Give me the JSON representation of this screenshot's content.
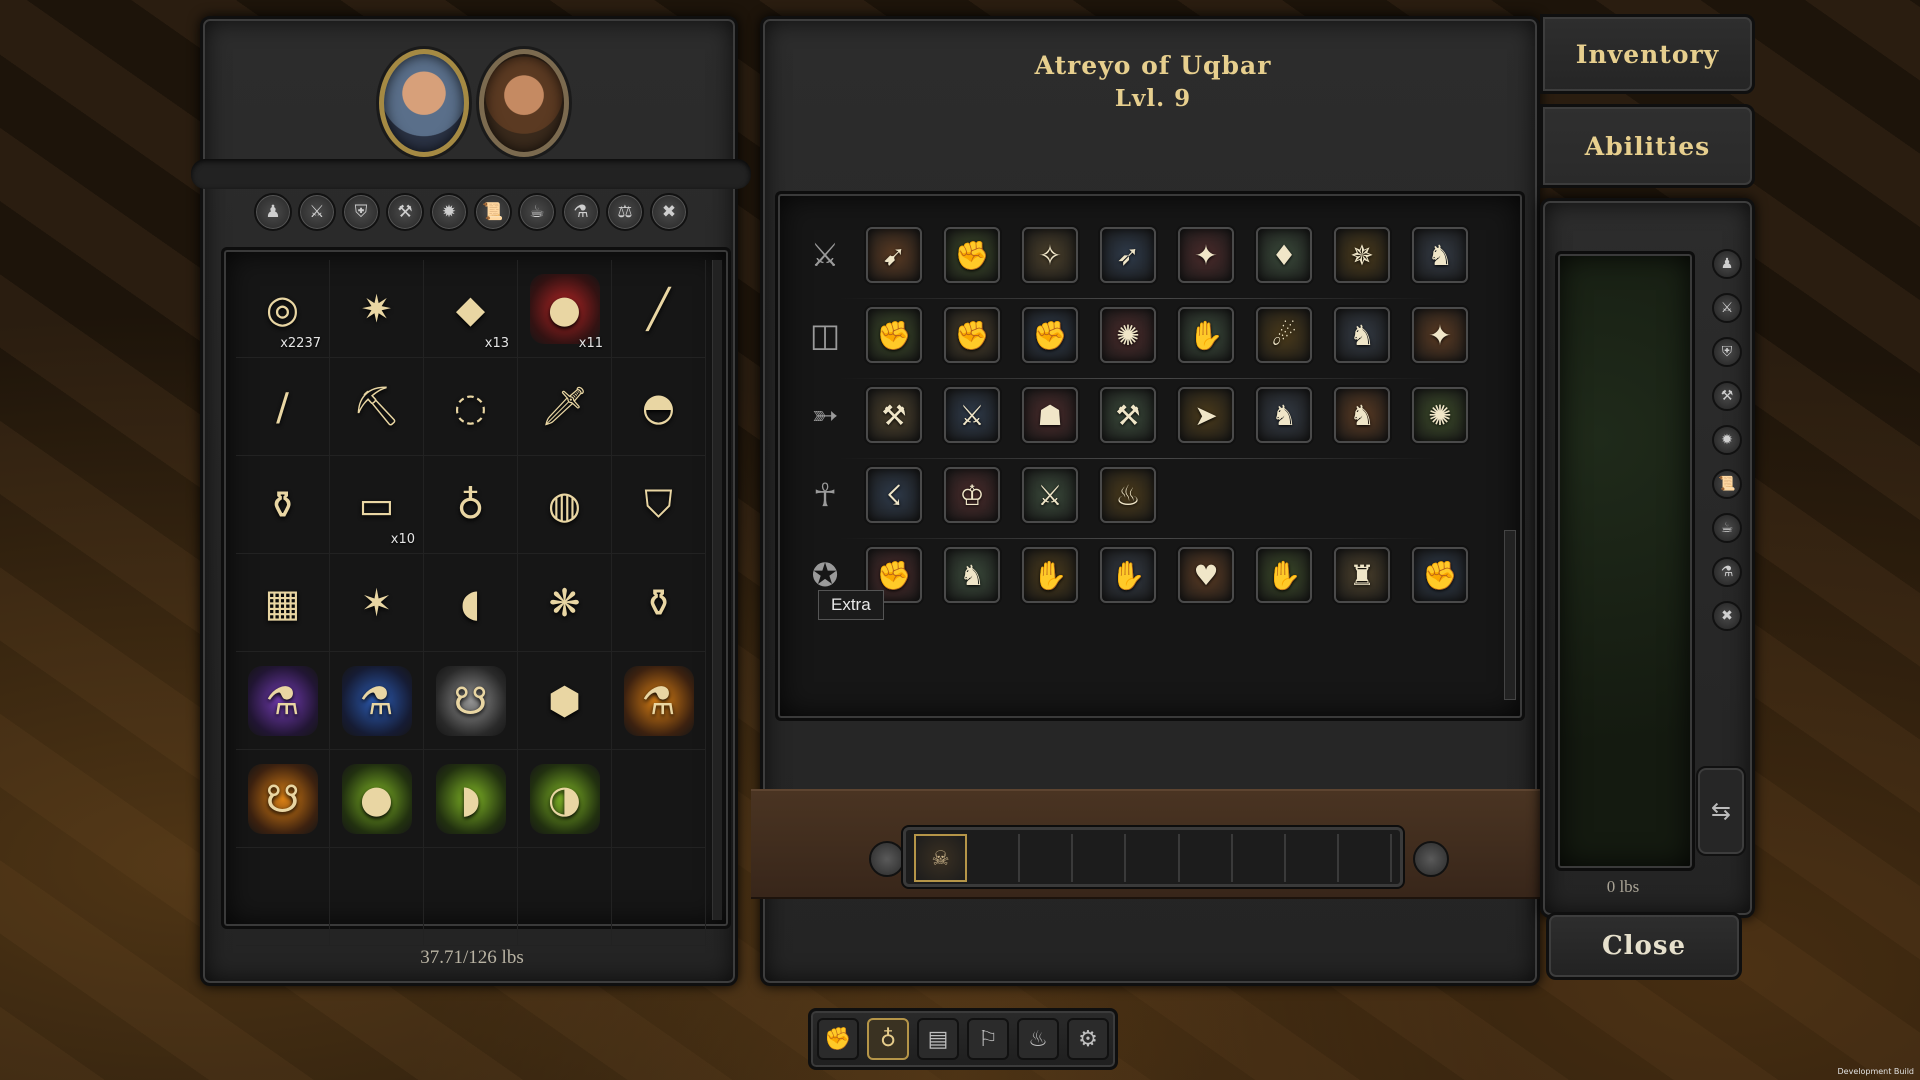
{
  "party": {
    "portraits": [
      {
        "name": "portrait-atreyo",
        "selected": true
      },
      {
        "name": "portrait-companion",
        "selected": false
      }
    ]
  },
  "inventory": {
    "filters": [
      {
        "name": "filter-all-icon",
        "glyph": "♟"
      },
      {
        "name": "filter-weapons-icon",
        "glyph": "⚔"
      },
      {
        "name": "filter-armor-icon",
        "glyph": "⛨"
      },
      {
        "name": "filter-tools-icon",
        "glyph": "⚒"
      },
      {
        "name": "filter-magic-icon",
        "glyph": "✹"
      },
      {
        "name": "filter-scrolls-icon",
        "glyph": "📜"
      },
      {
        "name": "filter-food-icon",
        "glyph": "☕"
      },
      {
        "name": "filter-potions-icon",
        "glyph": "⚗"
      },
      {
        "name": "filter-misc-icon",
        "glyph": "⚖"
      },
      {
        "name": "filter-junk-icon",
        "glyph": "✖"
      }
    ],
    "items": [
      {
        "name": "gold-coins",
        "glyph": "◎",
        "qty": "x2237",
        "glow": ""
      },
      {
        "name": "spiked-mace",
        "glyph": "✷",
        "qty": "",
        "glow": ""
      },
      {
        "name": "food-bundle",
        "glyph": "◆",
        "qty": "x13",
        "glow": ""
      },
      {
        "name": "raw-meat",
        "glyph": "●",
        "qty": "x11",
        "glow": "glow-red"
      },
      {
        "name": "wooden-club",
        "glyph": "╱",
        "qty": "",
        "glow": ""
      },
      {
        "name": "smoking-pipe",
        "glyph": "∕",
        "qty": "",
        "glow": ""
      },
      {
        "name": "pickaxe",
        "glyph": "⛏",
        "qty": "",
        "glow": ""
      },
      {
        "name": "bead-necklace",
        "glyph": "◌",
        "qty": "",
        "glow": ""
      },
      {
        "name": "blue-sword",
        "glyph": "🗡",
        "qty": "",
        "glow": ""
      },
      {
        "name": "leather-cap",
        "glyph": "◓",
        "qty": "",
        "glow": ""
      },
      {
        "name": "clay-bottle",
        "glyph": "⚱",
        "qty": "",
        "glow": ""
      },
      {
        "name": "bandage-roll",
        "glyph": "▭",
        "qty": "x10",
        "glow": ""
      },
      {
        "name": "coin-pouch",
        "glyph": "♁",
        "qty": "",
        "glow": ""
      },
      {
        "name": "salve-jar",
        "glyph": "◍",
        "qty": "",
        "glow": ""
      },
      {
        "name": "kite-shield",
        "glyph": "⛉",
        "qty": "",
        "glow": ""
      },
      {
        "name": "chainmail-shirt",
        "glyph": "▦",
        "qty": "",
        "glow": ""
      },
      {
        "name": "spiked-orb",
        "glyph": "✶",
        "qty": "",
        "glow": ""
      },
      {
        "name": "bread-loaf",
        "glyph": "◖",
        "qty": "",
        "glow": ""
      },
      {
        "name": "moss-bundle",
        "glyph": "❋",
        "qty": "",
        "glow": ""
      },
      {
        "name": "ceramic-urn",
        "glyph": "⚱",
        "qty": "",
        "glow": ""
      },
      {
        "name": "purple-flask",
        "glyph": "⚗",
        "qty": "",
        "glow": "glow-purple"
      },
      {
        "name": "blue-flask",
        "glyph": "⚗",
        "qty": "",
        "glow": "glow-blue"
      },
      {
        "name": "white-gourd",
        "glyph": "☋",
        "qty": "",
        "glow": "glow-white"
      },
      {
        "name": "honeycomb",
        "glyph": "⬢",
        "qty": "",
        "glow": ""
      },
      {
        "name": "orange-flask",
        "glyph": "⚗",
        "qty": "",
        "glow": "glow-orange"
      },
      {
        "name": "orange-gourd",
        "glyph": "☋",
        "qty": "",
        "glow": "glow-orange"
      },
      {
        "name": "green-jug-1",
        "glyph": "●",
        "qty": "",
        "glow": "glow-green"
      },
      {
        "name": "green-jug-2",
        "glyph": "◗",
        "qty": "",
        "glow": "glow-green"
      },
      {
        "name": "green-jug-3",
        "glyph": "◑",
        "qty": "",
        "glow": "glow-green"
      }
    ],
    "weight": "37.71/126 lbs"
  },
  "character": {
    "name": "Atreyo of Uqbar",
    "level": "Lvl. 9"
  },
  "abilities": {
    "rows": [
      {
        "name": "crossbow",
        "glyph": "⚔",
        "slots": [
          "➹",
          "✊",
          "✧",
          "➶",
          "✦",
          "♦",
          "✵",
          "♞"
        ]
      },
      {
        "name": "shield",
        "glyph": "◫",
        "slots": [
          "✊",
          "✊",
          "✊",
          "✺",
          "✋",
          "☄",
          "♞",
          "✦"
        ]
      },
      {
        "name": "blade",
        "glyph": "➳",
        "slots": [
          "⚒",
          "⚔",
          "☗",
          "⚒",
          "➤",
          "♞",
          "♞",
          "✺"
        ]
      },
      {
        "name": "meditation",
        "glyph": "☥",
        "slots": [
          "☇",
          "♔",
          "⚔",
          "♨"
        ]
      },
      {
        "name": "extra",
        "glyph": "✪",
        "slots": [
          "✊",
          "♞",
          "✋",
          "✋",
          "♥",
          "✋",
          "♜",
          "✊"
        ]
      }
    ],
    "tooltip": "Extra"
  },
  "hotbar": {
    "slots": [
      "☠",
      "",
      "",
      "",
      "",
      "",
      "",
      "",
      ""
    ]
  },
  "tabs": {
    "inventory": "Inventory",
    "abilities": "Abilities"
  },
  "stash": {
    "weight": "0 lbs",
    "side_buttons": [
      "♟",
      "⚔",
      "⛨",
      "⚒",
      "✹",
      "📜",
      "☕",
      "⚗",
      "✖"
    ],
    "transfer_glyph": "⇆"
  },
  "close_label": "Close",
  "toolbar": {
    "buttons": [
      {
        "name": "character-icon",
        "glyph": "✊",
        "active": false
      },
      {
        "name": "inventory-bag-icon",
        "glyph": "♁",
        "active": true
      },
      {
        "name": "journal-icon",
        "glyph": "▤",
        "active": false
      },
      {
        "name": "map-icon",
        "glyph": "⚐",
        "active": false
      },
      {
        "name": "camp-icon",
        "glyph": "♨",
        "active": false
      },
      {
        "name": "settings-gear-icon",
        "glyph": "⚙",
        "active": false
      }
    ]
  },
  "dev_build": "Development Build"
}
